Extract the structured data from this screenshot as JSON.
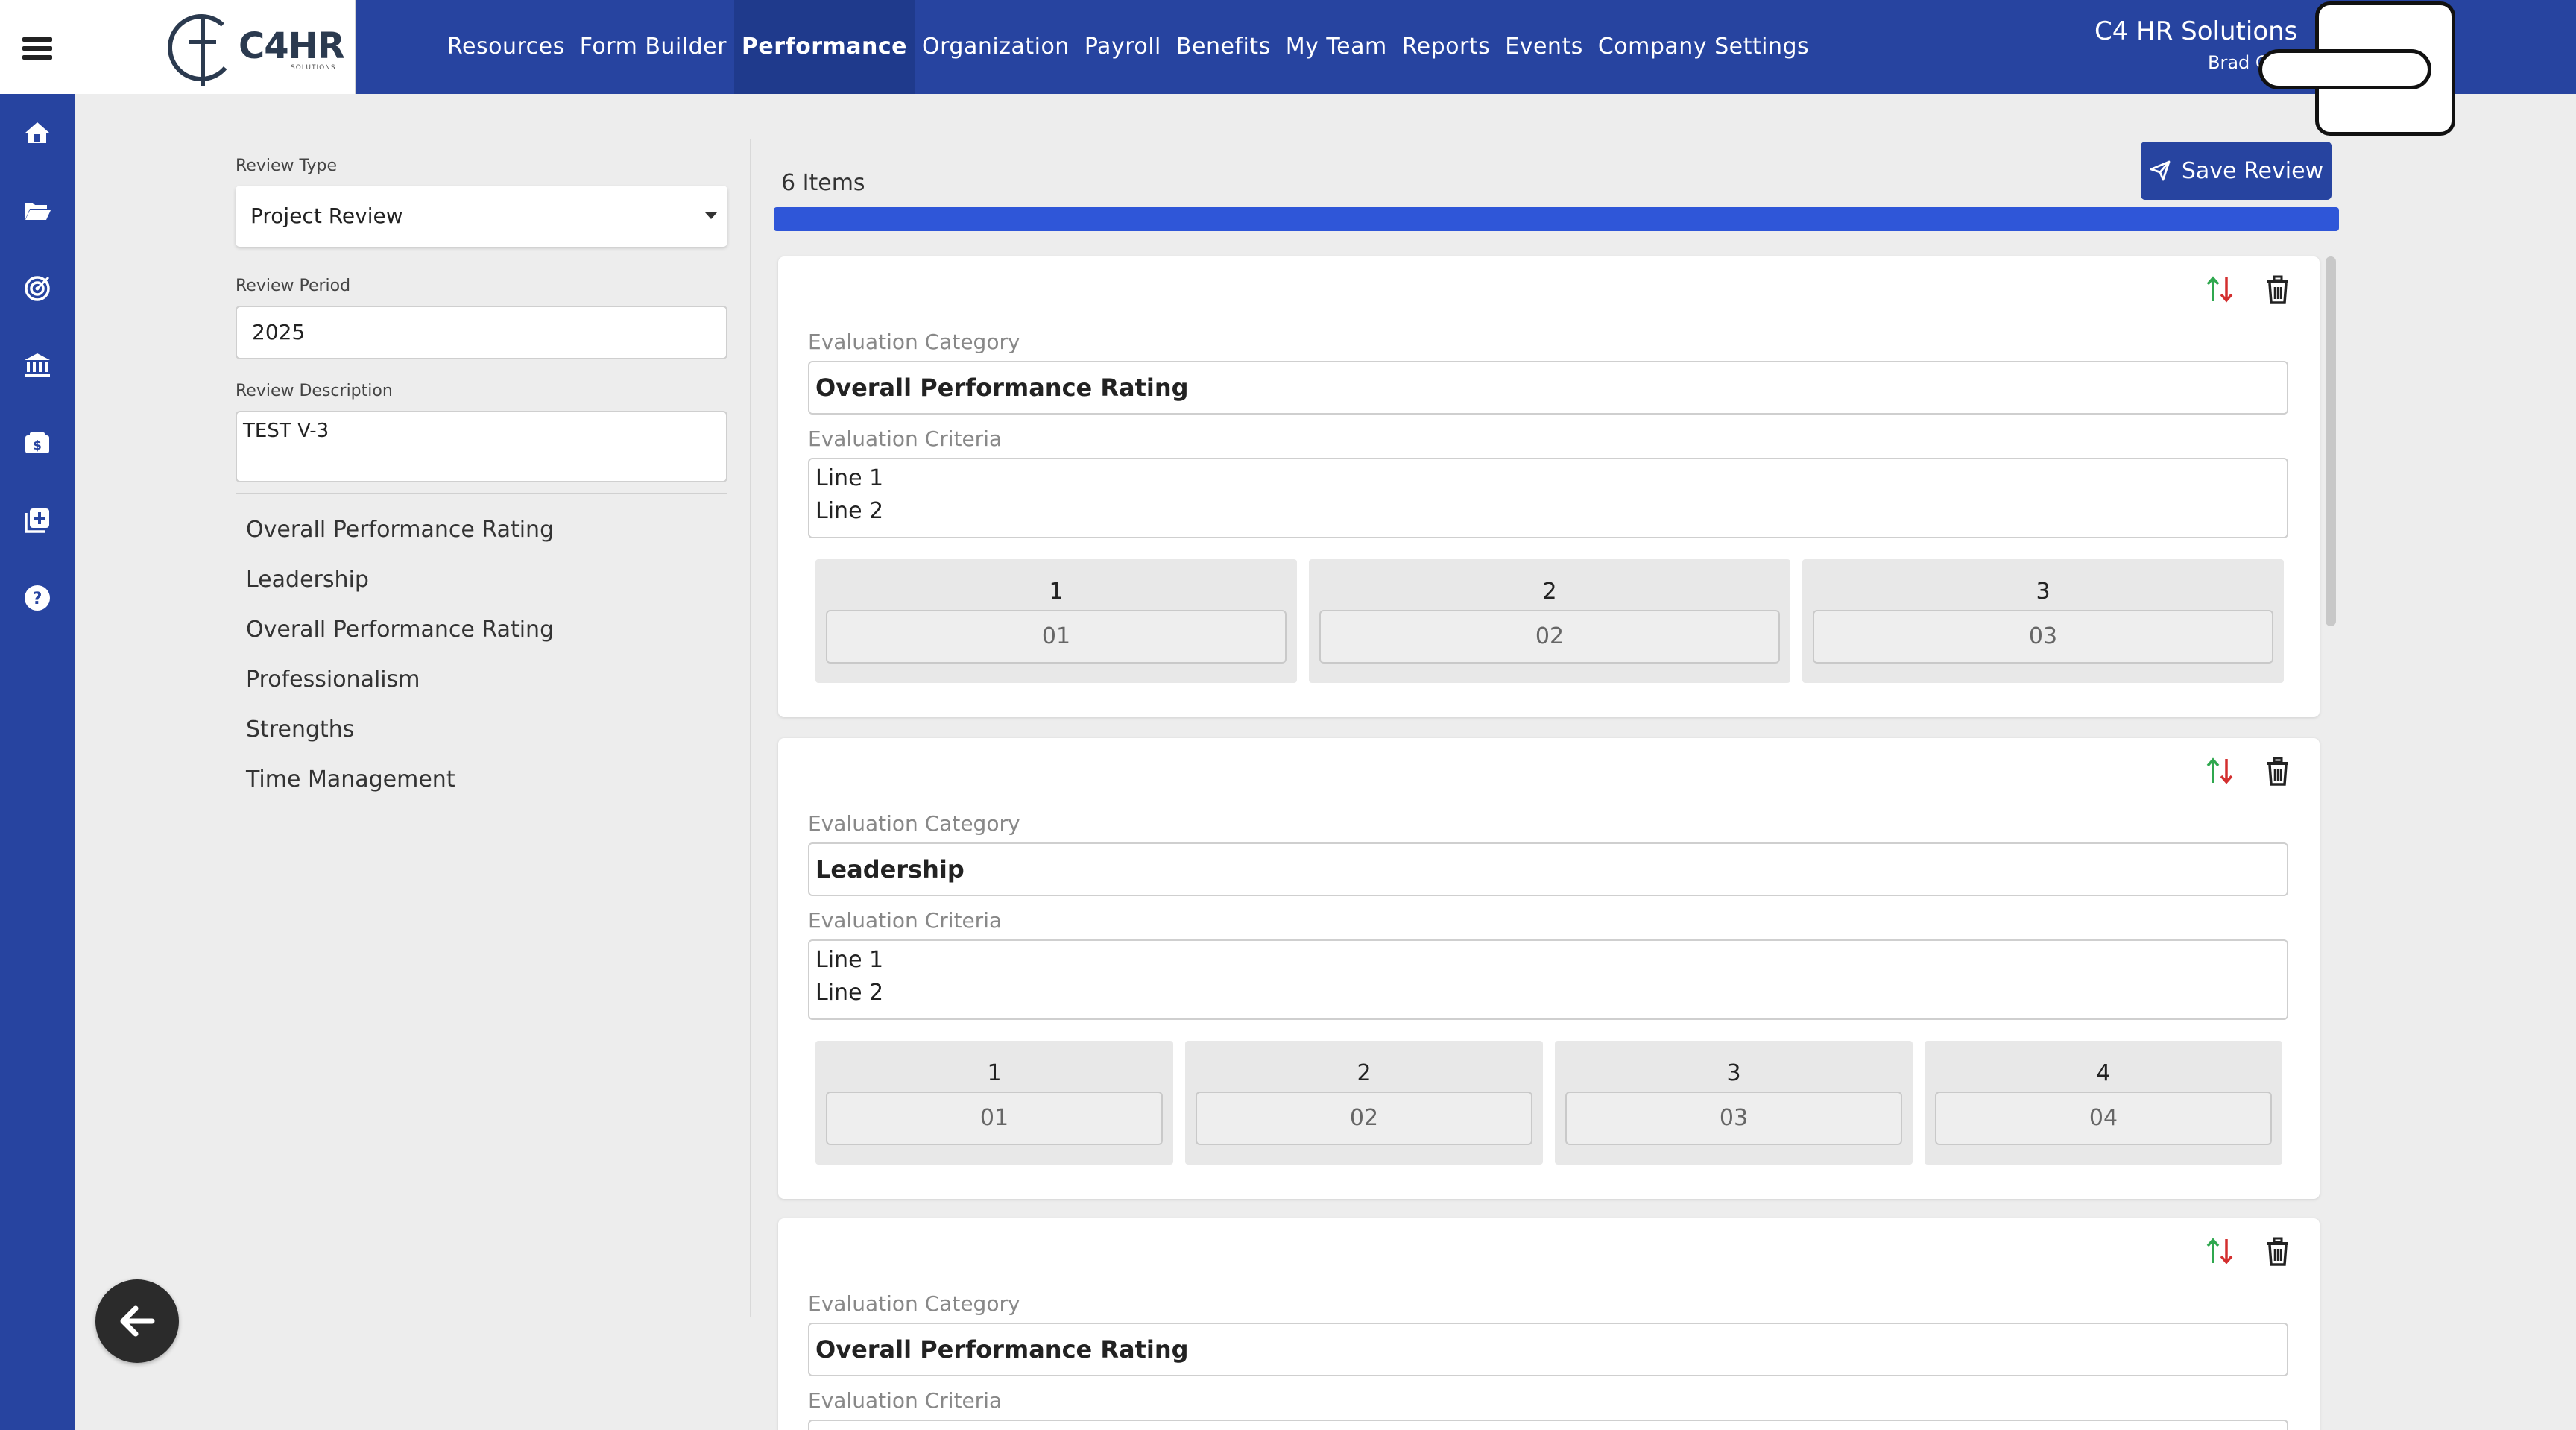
{
  "header": {
    "logo_text": "C4HR",
    "logo_sub": "SOLUTIONS",
    "nav": [
      "Resources",
      "Form Builder",
      "Performance",
      "Organization",
      "Payroll",
      "Benefits",
      "My Team",
      "Reports",
      "Events",
      "Company Settings"
    ],
    "active_nav": "Performance",
    "company": "C4 HR Solutions",
    "user": "Brad C"
  },
  "sidebar": {
    "icons": [
      "home-icon",
      "folder-open-icon",
      "target-icon",
      "bank-icon",
      "money-icon",
      "medical-plus-icon",
      "help-icon"
    ]
  },
  "form": {
    "review_type_label": "Review Type",
    "review_type_value": "Project Review",
    "review_period_label": "Review Period",
    "review_period_value": "2025",
    "review_description_label": "Review Description",
    "review_description_value": "TEST V-3",
    "categories": [
      "Overall Performance Rating",
      "Leadership",
      "Overall Performance Rating",
      "Professionalism",
      "Strengths",
      "Time Management"
    ]
  },
  "main": {
    "items_count": "6 Items",
    "save_label": "Save Review",
    "progress_fraction": 1.0,
    "category_label": "Evaluation Category",
    "criteria_label": "Evaluation Criteria",
    "cards": [
      {
        "category": "Overall Performance Rating",
        "criteria_lines": [
          "Line 1",
          "Line 2"
        ],
        "scale": [
          {
            "num": "1",
            "value": "01"
          },
          {
            "num": "2",
            "value": "02"
          },
          {
            "num": "3",
            "value": "03"
          }
        ]
      },
      {
        "category": "Leadership",
        "criteria_lines": [
          "Line 1",
          "Line 2"
        ],
        "scale": [
          {
            "num": "1",
            "value": "01"
          },
          {
            "num": "2",
            "value": "02"
          },
          {
            "num": "3",
            "value": "03"
          },
          {
            "num": "4",
            "value": "04"
          }
        ]
      },
      {
        "category": "Overall Performance Rating",
        "criteria_lines": [],
        "scale": []
      }
    ]
  },
  "colors": {
    "brand_blue": "#2744a0",
    "progress_blue": "#2f56d8",
    "arrow_up_green": "#2fa84f",
    "arrow_down_red": "#d32f2f"
  }
}
